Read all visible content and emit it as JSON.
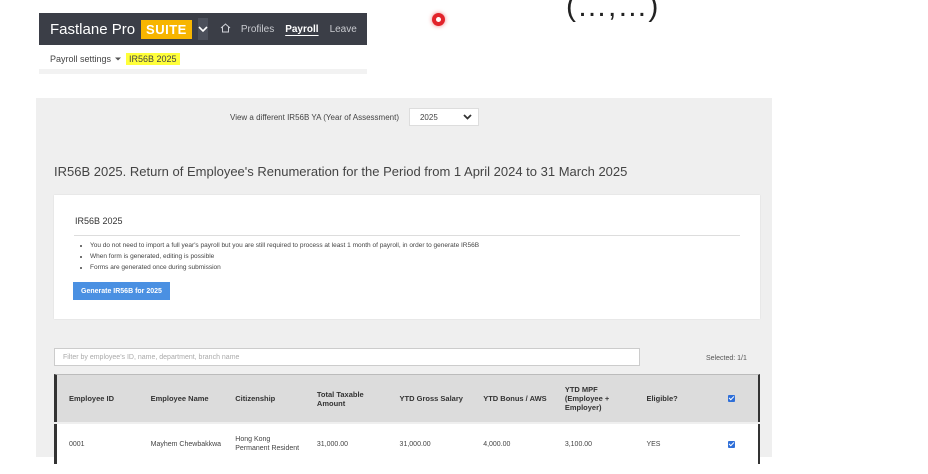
{
  "corner_text": "(…,…)",
  "nav": {
    "brand": "Fastlane Pro",
    "suite": "SUITE",
    "items": [
      {
        "label": "Profiles",
        "active": false
      },
      {
        "label": "Payroll",
        "active": true
      },
      {
        "label": "Leave",
        "active": false
      }
    ]
  },
  "breadcrumb": {
    "parent": "Payroll settings",
    "current": "IR56B 2025"
  },
  "ya_selector": {
    "label": "View a different IR56B YA (Year of Assessment)",
    "value": "2025"
  },
  "page_title": "IR56B 2025. Return of Employee's Renumeration for the Period from 1 April 2024 to 31 March 2025",
  "card": {
    "title": "IR56B 2025",
    "bullets": [
      "You do not need to import a full year's payroll but you are still required to process at least 1 month of payroll, in order to generate IR56B",
      "When form is generated, editing is possible",
      "Forms are generated once during submission"
    ],
    "generate_button": "Generate IR56B for 2025"
  },
  "filter": {
    "placeholder": "Filter by employee's ID, name, department, branch name",
    "selected": "Selected: 1/1"
  },
  "table": {
    "headers": {
      "employee_id": "Employee ID",
      "employee_name": "Employee Name",
      "citizenship": "Citizenship",
      "taxable": "Total Taxable Amount",
      "gross": "YTD Gross Salary",
      "bonus": "YTD Bonus / AWS",
      "mpf": "YTD MPF (Employee + Employer)",
      "eligible": "Eligible?"
    },
    "rows": [
      {
        "employee_id": "0001",
        "employee_name": "Mayhem Chewbakkwa",
        "citizenship": "Hong Kong Permanent Resident",
        "taxable": "31,000.00",
        "gross": "31,000.00",
        "bonus": "4,000.00",
        "mpf": "3,100.00",
        "eligible": "YES"
      }
    ]
  },
  "colors": {
    "nav_bg": "#3b3e47",
    "suite_accent": "#f7b500",
    "highlight": "#ffff3a",
    "primary_button": "#4a90e2",
    "record_dot": "#e2242b"
  }
}
